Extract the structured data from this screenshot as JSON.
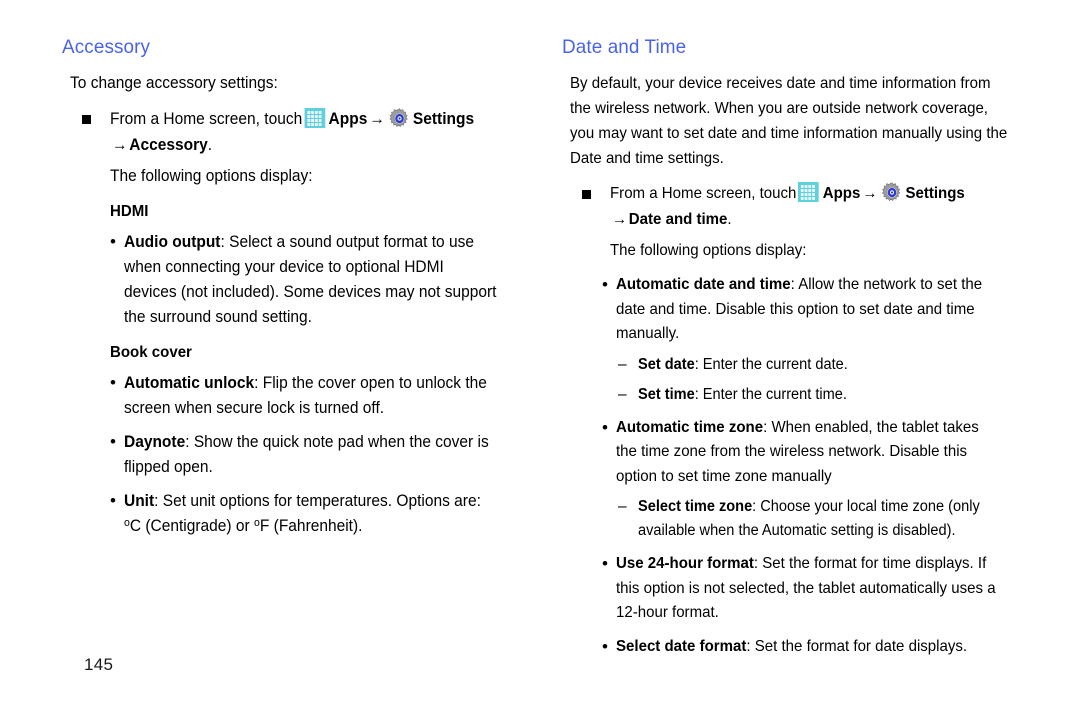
{
  "page": {
    "number": "145"
  },
  "icons": {
    "apps": "apps-grid-icon",
    "settings": "settings-gear-icon",
    "arrow": "→"
  },
  "colors": {
    "heading": "#4a63e7",
    "apps_icon": "#5ed0de",
    "gear_ring": "#2b39d6",
    "text": "#000000"
  },
  "left_column": {
    "heading": "Accessory",
    "intro": "To change accessory settings:",
    "step": {
      "lead": "From a Home screen, touch",
      "apps_label": "Apps",
      "settings_label": "Settings",
      "sub_target": "Accessory",
      "sub_period": ".",
      "follow": "The following options display:"
    },
    "subhead_hdmi": "HDMI",
    "bullets_hdmi": [
      {
        "term": "Audio output",
        "desc": ": Select a sound output format to use when connecting your device to optional HDMI devices (not included). Some devices may not support the surround sound setting."
      }
    ],
    "subhead_bookcover": "Book cover",
    "bullets_bookcover": [
      {
        "term": "Automatic unlock",
        "desc": ": Flip the cover open to unlock the screen when secure lock is turned off."
      },
      {
        "term": "Daynote",
        "desc": ": Show the quick note pad when the cover is flipped open."
      },
      {
        "term": "Unit",
        "desc": ": Set unit options for temperatures. Options are:",
        "desc2_pre": "C (Centigrade) or ",
        "desc2_post": "F (Fahrenheit)."
      }
    ]
  },
  "right_column": {
    "heading": "Date and Time",
    "intro": "By default, your device receives date and time information from the wireless network. When you are outside network coverage, you may want to set date and time information manually using the Date and time settings.",
    "step": {
      "lead": "From a Home screen, touch",
      "apps_label": "Apps",
      "settings_label": "Settings",
      "sub_target": "Date and time",
      "sub_period": ".",
      "follow": "The following options display:"
    },
    "bullets": [
      {
        "term": "Automatic date and time",
        "desc": ": Allow the network to set the date and time. Disable this option to set date and time manually.",
        "sub": [
          {
            "term": "Set date",
            "desc": ": Enter the current date."
          },
          {
            "term": "Set time",
            "desc": ": Enter the current time."
          }
        ]
      },
      {
        "term": "Automatic time zone",
        "desc": ": When enabled, the tablet takes the time zone from the wireless network. Disable this option to set time zone manually",
        "sub": [
          {
            "term": "Select time zone",
            "desc": ": Choose your local time zone (only available when the Automatic setting is disabled)."
          }
        ]
      },
      {
        "term": "Use 24-hour format",
        "desc": ": Set the format for time displays. If this option is not selected, the tablet automatically uses a 12-hour format.",
        "sub": []
      },
      {
        "term": "Select date format",
        "desc": ": Set the format for date displays.",
        "sub": []
      }
    ]
  }
}
